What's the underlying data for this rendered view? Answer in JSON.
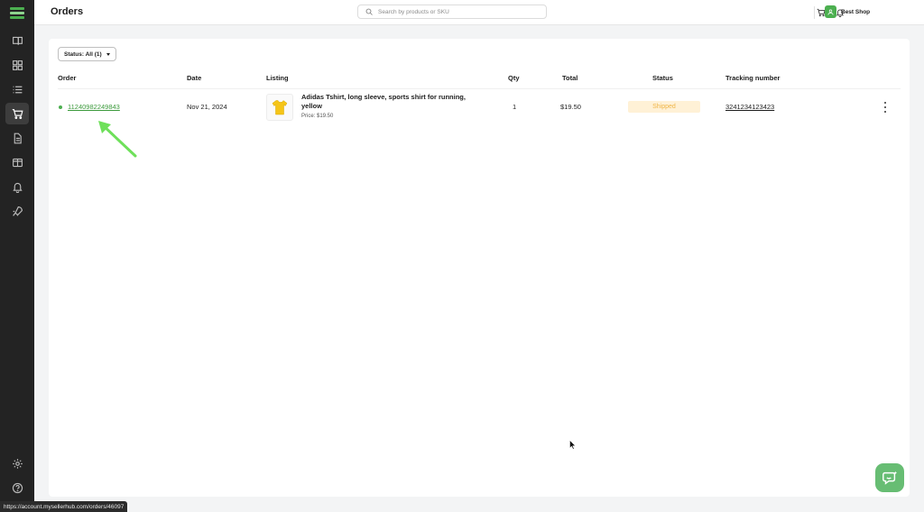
{
  "header": {
    "title": "Orders",
    "search_placeholder": "Search by products or SKU",
    "shop_name": "Best Shop"
  },
  "sidebar": {
    "items": [
      {
        "name": "catalog",
        "icon": "book-icon"
      },
      {
        "name": "dashboard",
        "icon": "grid-icon"
      },
      {
        "name": "listings",
        "icon": "list-icon"
      },
      {
        "name": "orders",
        "icon": "cart-icon",
        "active": true
      },
      {
        "name": "documents",
        "icon": "document-icon"
      },
      {
        "name": "wallet",
        "icon": "wallet-icon"
      },
      {
        "name": "notifications",
        "icon": "bell-icon"
      },
      {
        "name": "promote",
        "icon": "rocket-icon"
      },
      {
        "name": "settings",
        "icon": "gear-icon"
      },
      {
        "name": "help",
        "icon": "help-icon"
      }
    ]
  },
  "filter": {
    "status_label": "Status: All (1)"
  },
  "table": {
    "columns": {
      "order": "Order",
      "date": "Date",
      "listing": "Listing",
      "qty": "Qty",
      "total": "Total",
      "status": "Status",
      "tracking": "Tracking number"
    },
    "rows": [
      {
        "order_id": "11240982249843",
        "date": "Nov 21, 2024",
        "listing_title": "Adidas Tshirt, long sleeve, sports shirt for running, yellow",
        "listing_price": "Price: $19.50",
        "qty": "1",
        "total": "$19.50",
        "status": "Shipped",
        "tracking": "3241234123423"
      }
    ]
  },
  "colors": {
    "accent": "#4caf50",
    "link": "#3c9a3c",
    "status_shipped_bg": "#fff1d6",
    "status_shipped_text": "#f0b547",
    "sidebar_bg": "#232323",
    "annotation_arrow": "#6ee05a"
  },
  "statusbar": {
    "url": "https://account.mysellerhub.com/orders/46097"
  }
}
